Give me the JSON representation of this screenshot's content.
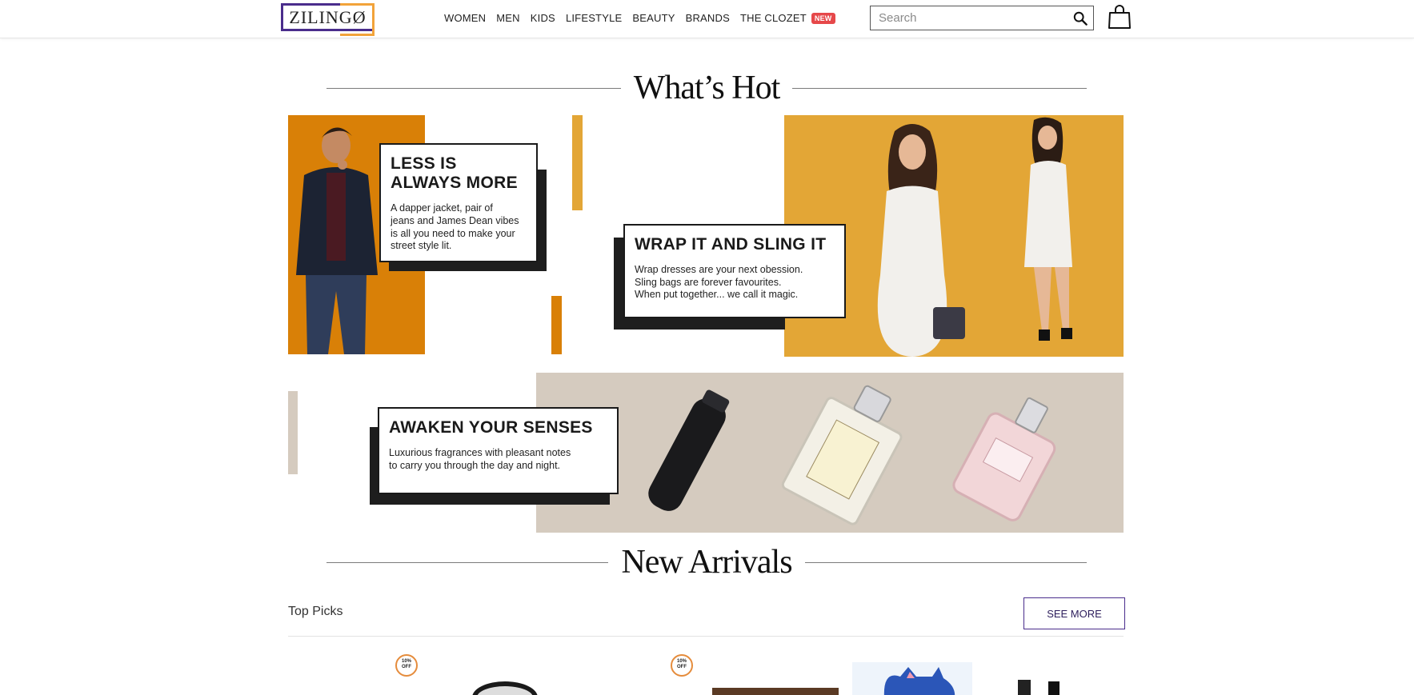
{
  "header": {
    "logo_text": "ZILINGØ",
    "nav": [
      {
        "label": "WOMEN"
      },
      {
        "label": "MEN"
      },
      {
        "label": "KIDS"
      },
      {
        "label": "LIFESTYLE"
      },
      {
        "label": "BEAUTY"
      },
      {
        "label": "BRANDS"
      },
      {
        "label": "THE CLOZET",
        "badge": "NEW"
      }
    ],
    "search": {
      "placeholder": "Search"
    },
    "bag_icon": "shopping-bag-icon"
  },
  "whats_hot": {
    "title": "What’s Hot",
    "promos": [
      {
        "title_line1": "LESS IS",
        "title_line2": "ALWAYS MORE",
        "body_line1": "A dapper jacket, pair of",
        "body_line2": "jeans and James Dean vibes",
        "body_line3": "is all you need to make your",
        "body_line4": "street style lit."
      },
      {
        "title": "WRAP IT AND SLING IT",
        "body_line1": "Wrap dresses are your next obession.",
        "body_line2": "Sling bags are forever favourites.",
        "body_line3": "When put together... we call it magic."
      },
      {
        "title": "AWAKEN YOUR SENSES",
        "body_line1": "Luxurious fragrances with pleasant notes",
        "body_line2": "to carry you through the day and night."
      }
    ]
  },
  "new_arrivals": {
    "title": "New Arrivals",
    "top_picks_label": "Top Picks",
    "see_more_label": "SEE MORE",
    "discount_badge": {
      "line1": "10%",
      "line2": "OFF"
    }
  },
  "colors": {
    "brand_purple": "#4a2d8c",
    "brand_orange": "#f2a33a",
    "tile_orange": "#d98007",
    "tile_mustard": "#e3a636",
    "tile_beige": "#d5cbbf"
  }
}
